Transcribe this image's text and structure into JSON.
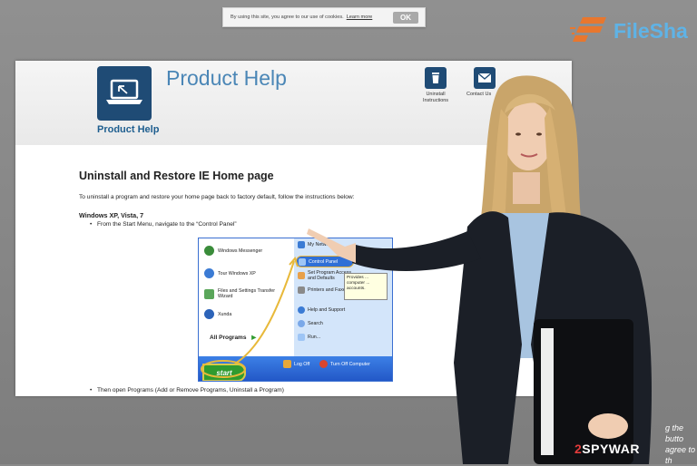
{
  "cookie": {
    "text": "By using this site, you agree to our use of cookies.",
    "learn_more": "Learn more",
    "ok": "OK"
  },
  "brand": {
    "name": "FileSha"
  },
  "page": {
    "header_title": "Product Help",
    "logo_label": "Product Help",
    "nav": [
      {
        "label_line1": "Uninstall",
        "label_line2": "Instructions",
        "icon": "trash-icon"
      },
      {
        "label_line1": "Contact Us",
        "label_line2": "",
        "icon": "envelope-icon"
      }
    ],
    "title": "Uninstall and Restore IE Home page",
    "intro": "To uninstall a program and restore your home page back to factory default, follow the instructions below:",
    "os_heading": "Windows XP, Vista, 7",
    "step1": "From the Start Menu, navigate to the “Control Panel”",
    "step2": "Then open Programs (Add or Remove Programs, Uninstall a Program)"
  },
  "xp_menu": {
    "left_items": [
      "Windows Messenger",
      "Tour Windows XP",
      "Files and Settings Transfer Wizard",
      "Xunda"
    ],
    "all_programs": "All Programs",
    "right_items": [
      "My Netw...",
      "Control Panel",
      "Set Program Access and Defaults",
      "Printers and Faxes",
      "Help and Support",
      "Search",
      "Run..."
    ],
    "tooltip": "Provides ... computer ... accounts.",
    "log_off": "Log Off",
    "turn_off": "Turn Off Computer",
    "start": "start"
  },
  "overlay": {
    "side_line1": "g the butto",
    "side_line2": "agree to th",
    "watermark_prefix": "2",
    "watermark_main": "SPYWAR"
  },
  "colors": {
    "accent_blue": "#1f4b75",
    "title_blue": "#4a86b6",
    "brand_blue": "#5fb3e6"
  }
}
